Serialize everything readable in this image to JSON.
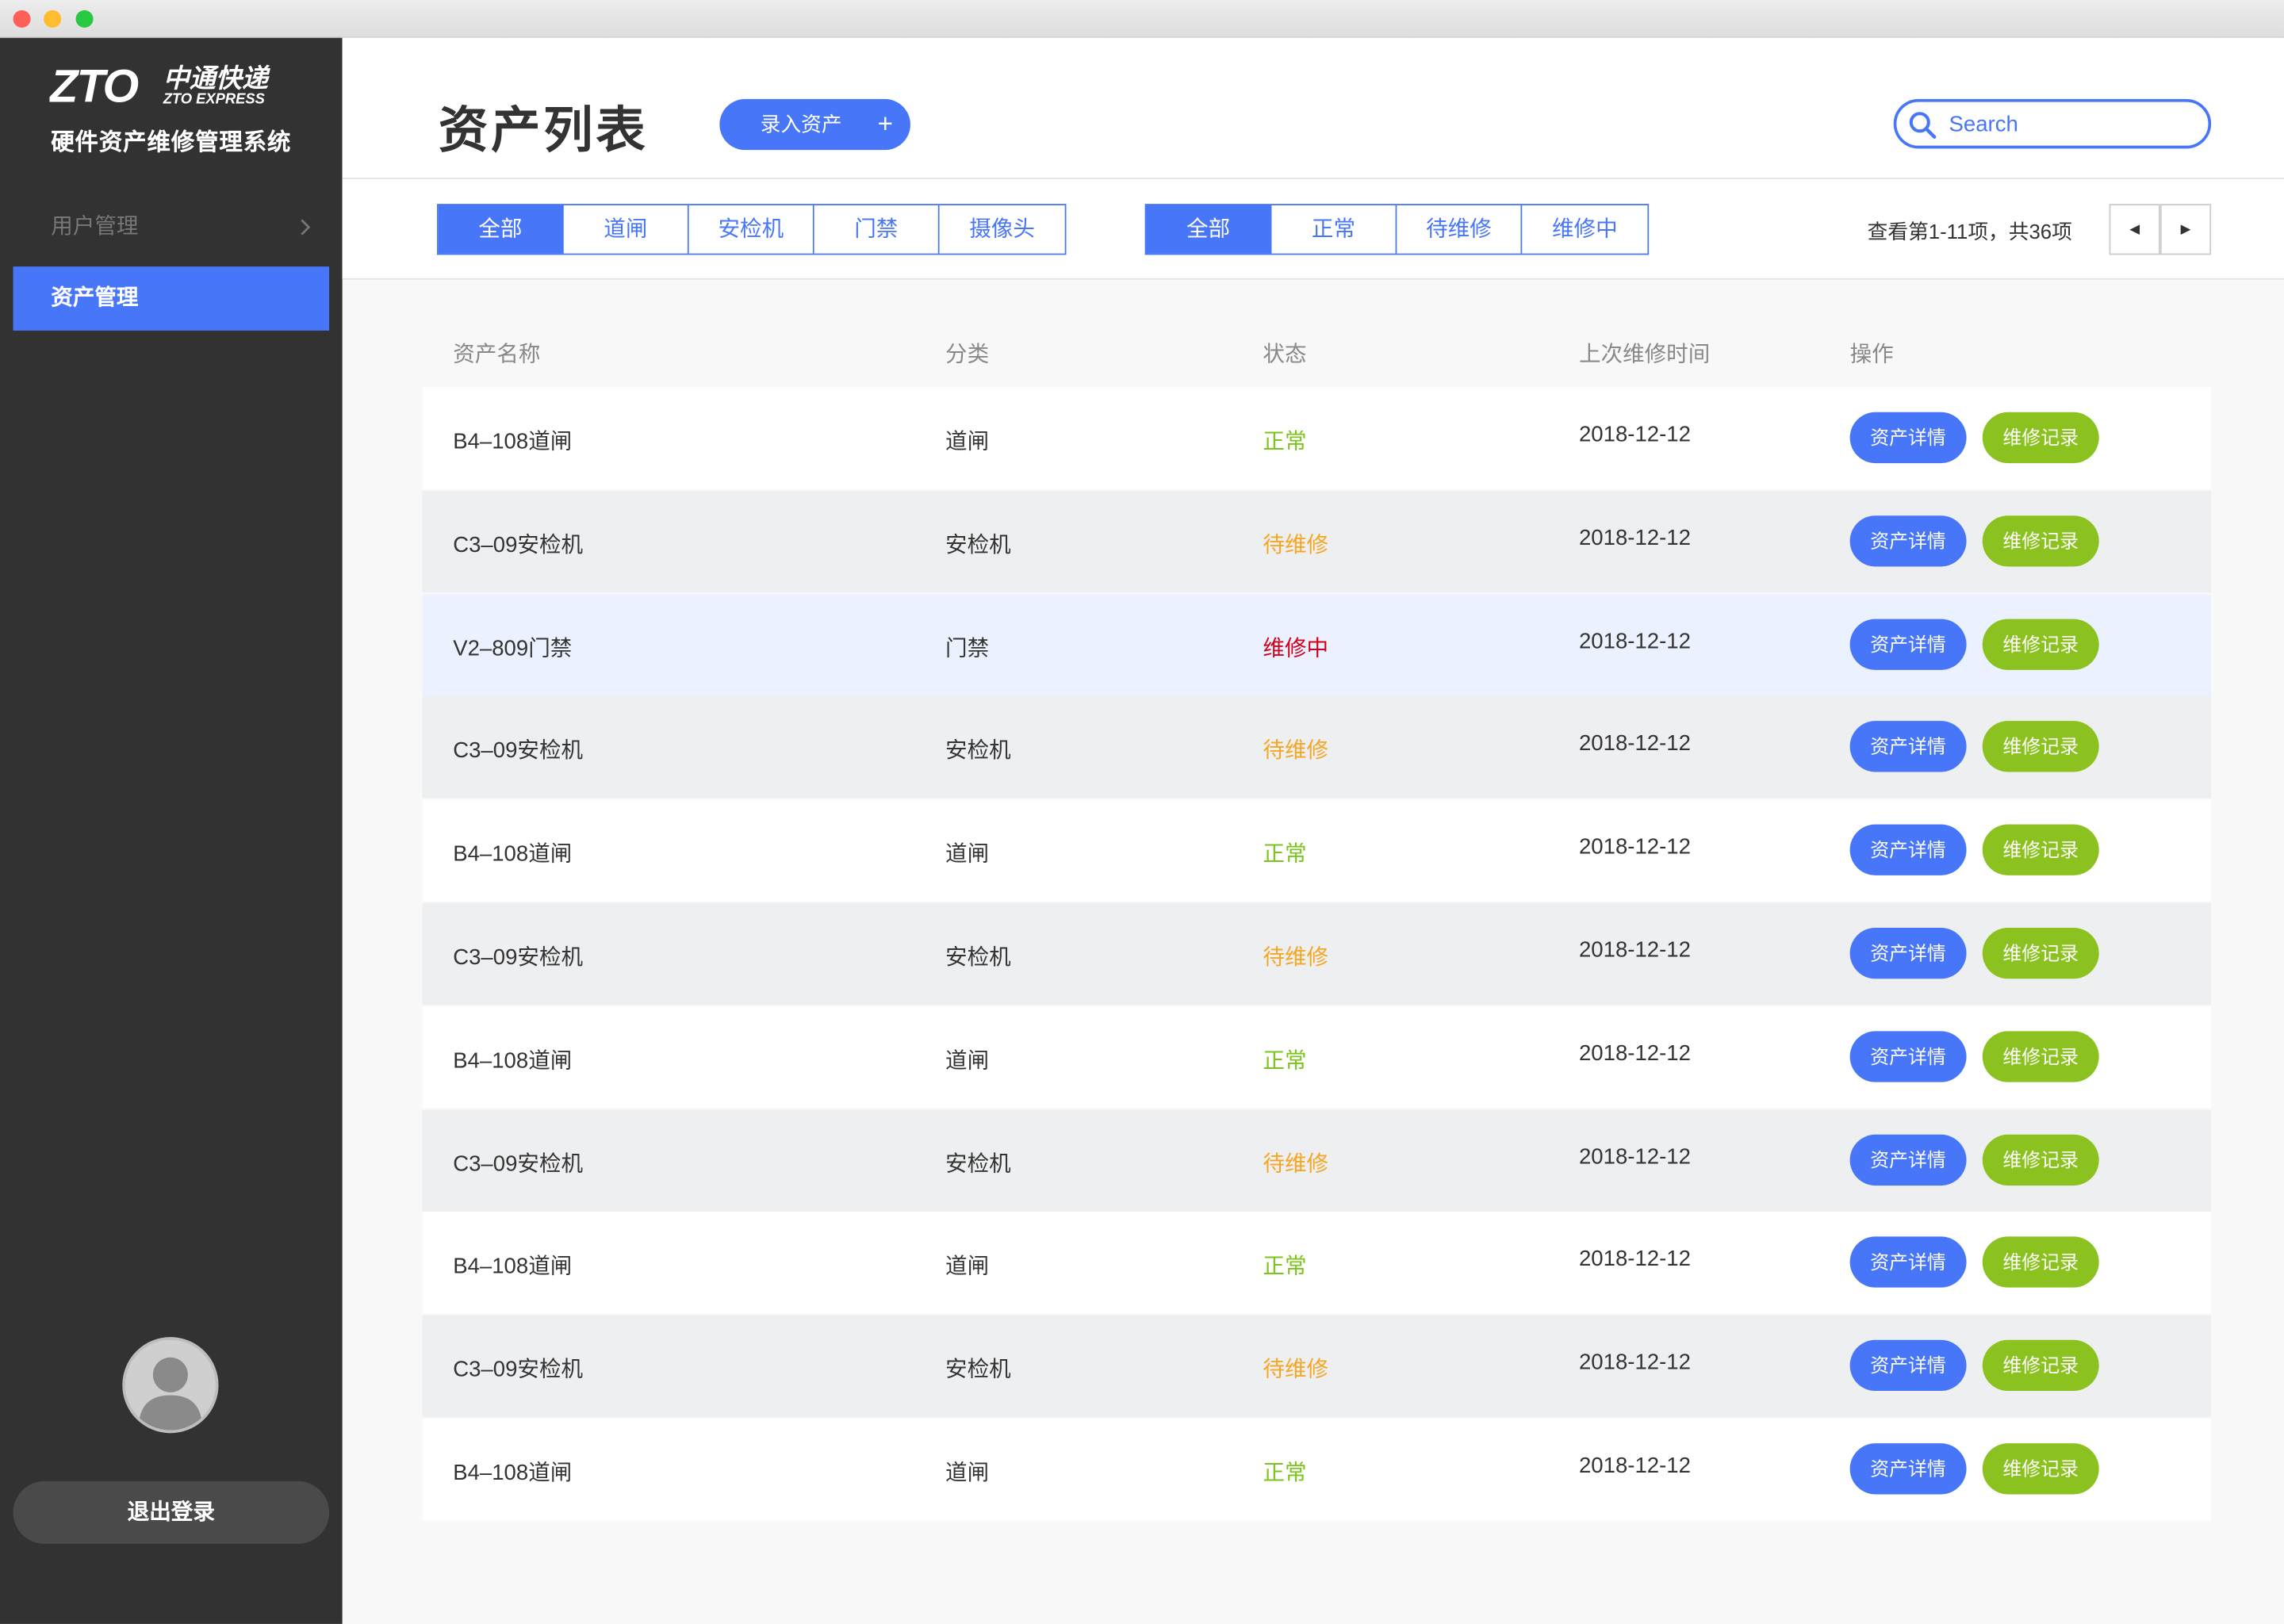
{
  "window": {
    "traffic_lights": {
      "close": "#fe5f57",
      "minimize": "#febc2e",
      "zoom": "#28c840"
    }
  },
  "brand": {
    "logo_text": "ZTO",
    "logo_cn": "中通快递",
    "logo_en": "ZTO EXPRESS",
    "app_title": "硬件资产维修管理系统"
  },
  "sidebar": {
    "items": [
      {
        "label": "用户管理",
        "icon": "chevron-right-icon"
      },
      {
        "label": "资产管理"
      }
    ],
    "logout_label": "退出登录"
  },
  "header": {
    "title": "资产列表",
    "add_label": "录入资产",
    "add_icon": "+",
    "search_placeholder": "Search"
  },
  "filters": {
    "category": [
      "全部",
      "道闸",
      "安检机",
      "门禁",
      "摄像头"
    ],
    "category_selected": 0,
    "status": [
      "全部",
      "正常",
      "待维修",
      "维修中"
    ],
    "status_selected": 0
  },
  "pagination": {
    "info": "查看第1-11项，共36项",
    "prev": "◀",
    "next": "▶"
  },
  "table": {
    "columns": [
      "资产名称",
      "分类",
      "状态",
      "上次维修时间",
      "操作"
    ],
    "detail_label": "资产详情",
    "record_label": "维修记录",
    "rows": [
      {
        "name": "B4–108道闸",
        "category": "道闸",
        "status": "正常",
        "date": "2018-12-12"
      },
      {
        "name": "C3–09安检机",
        "category": "安检机",
        "status": "待维修",
        "date": "2018-12-12"
      },
      {
        "name": "V2–809门禁",
        "category": "门禁",
        "status": "维修中",
        "date": "2018-12-12"
      },
      {
        "name": "C3–09安检机",
        "category": "安检机",
        "status": "待维修",
        "date": "2018-12-12"
      },
      {
        "name": "B4–108道闸",
        "category": "道闸",
        "status": "正常",
        "date": "2018-12-12"
      },
      {
        "name": "C3–09安检机",
        "category": "安检机",
        "status": "待维修",
        "date": "2018-12-12"
      },
      {
        "name": "B4–108道闸",
        "category": "道闸",
        "status": "正常",
        "date": "2018-12-12"
      },
      {
        "name": "C3–09安检机",
        "category": "安检机",
        "status": "待维修",
        "date": "2018-12-12"
      },
      {
        "name": "B4–108道闸",
        "category": "道闸",
        "status": "正常",
        "date": "2018-12-12"
      },
      {
        "name": "C3–09安检机",
        "category": "安检机",
        "status": "待维修",
        "date": "2018-12-12"
      },
      {
        "name": "B4–108道闸",
        "category": "道闸",
        "status": "正常",
        "date": "2018-12-12"
      }
    ],
    "highlighted_row": 2
  },
  "colors": {
    "primary": "#4876f8",
    "success_button": "#8cc21f",
    "status_normal": "#7bc41c",
    "status_pending": "#f5a623",
    "status_repairing": "#d0021b",
    "sidebar_bg": "#323232",
    "row_alt": "#eeeff1",
    "row_highlight": "#ebf1fe"
  }
}
